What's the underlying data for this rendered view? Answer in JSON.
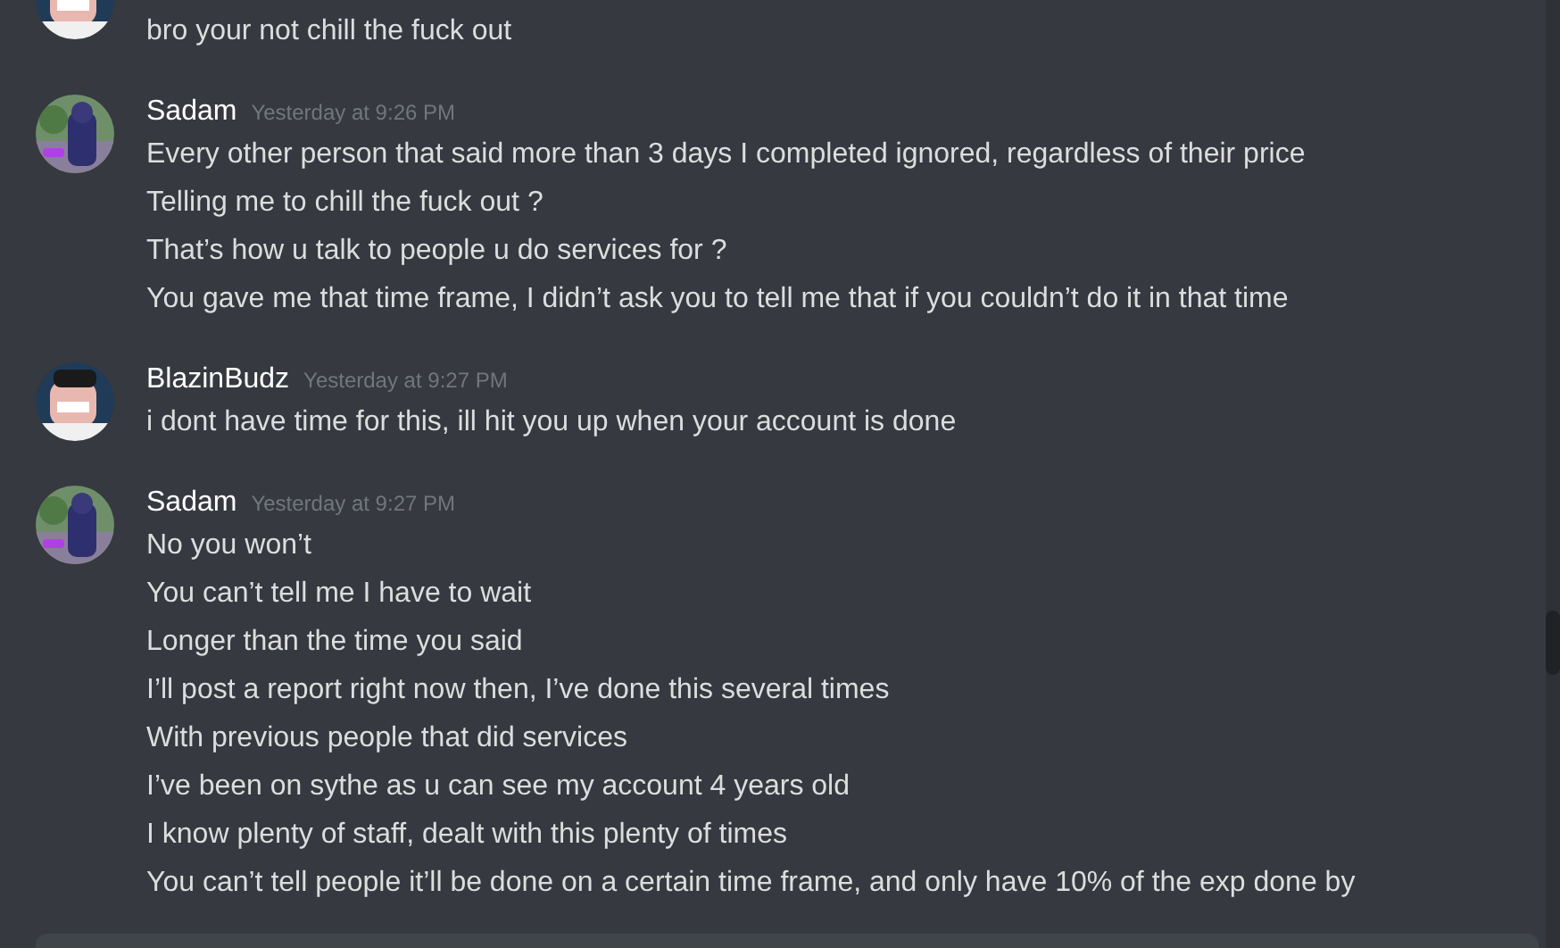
{
  "messages": [
    {
      "lines": [
        "bro your not chill the fuck out"
      ]
    },
    {
      "author": "Sadam",
      "timestamp": "Yesterday at 9:26 PM",
      "lines": [
        "Every other person that said more than 3 days I completed ignored, regardless of their price",
        "Telling me to chill the fuck out ?",
        "That’s how u talk to people u do services for ?",
        "You gave me that time frame, I didn’t ask you to tell me that if you couldn’t do it in that time"
      ]
    },
    {
      "author": "BlazinBudz",
      "timestamp": "Yesterday at 9:27 PM",
      "lines": [
        "i dont have time for this, ill hit you up when your account is done"
      ]
    },
    {
      "author": "Sadam",
      "timestamp": "Yesterday at 9:27 PM",
      "lines": [
        "No you won’t",
        "You can’t tell me I have to wait",
        "Longer than the time you said",
        "I’ll post a report right now then, I’ve done this several times",
        "With previous people that did services",
        "I’ve been on sythe as u can see my account 4 years old",
        "I know plenty of staff, dealt with this plenty of times",
        "You can’t tell people it’ll be done on a certain time frame, and only have 10% of the exp done by"
      ]
    }
  ]
}
